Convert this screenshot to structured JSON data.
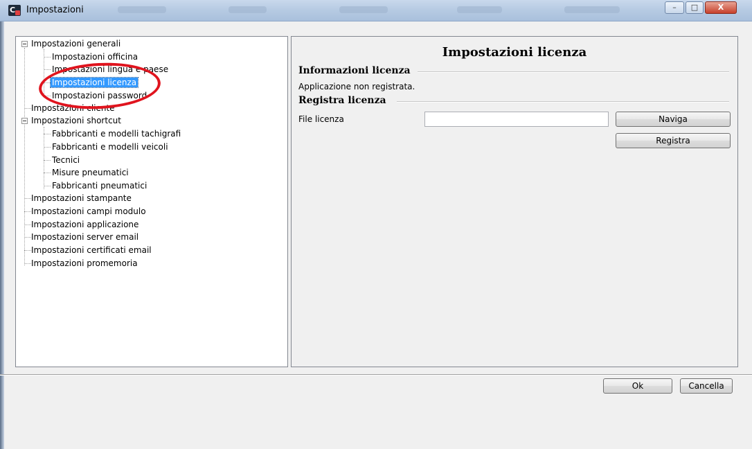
{
  "window": {
    "title": "Impostazioni",
    "controls": {
      "minimize": "–",
      "maximize": "□",
      "close": "X"
    }
  },
  "tree": {
    "items": [
      {
        "label": "Impostazioni generali",
        "level": 0,
        "expander": true
      },
      {
        "label": "Impostazioni officina",
        "level": 1
      },
      {
        "label": "Impostazioni lingua e paese",
        "level": 1
      },
      {
        "label": "Impostazioni licenza",
        "level": 1,
        "selected": true
      },
      {
        "label": "Impostazioni password",
        "level": 1
      },
      {
        "label": "Impostazioni cliente",
        "level": 0
      },
      {
        "label": "Impostazioni shortcut",
        "level": 0,
        "expander": true
      },
      {
        "label": "Fabbricanti e modelli tachigrafi",
        "level": 1
      },
      {
        "label": "Fabbricanti e modelli veicoli",
        "level": 1
      },
      {
        "label": "Tecnici",
        "level": 1
      },
      {
        "label": "Misure pneumatici",
        "level": 1
      },
      {
        "label": "Fabbricanti pneumatici",
        "level": 1
      },
      {
        "label": "Impostazioni stampante",
        "level": 0
      },
      {
        "label": "Impostazioni campi modulo",
        "level": 0
      },
      {
        "label": "Impostazioni applicazione",
        "level": 0
      },
      {
        "label": "Impostazioni server email",
        "level": 0
      },
      {
        "label": "Impostazioni certificati email",
        "level": 0
      },
      {
        "label": "Impostazioni promemoria",
        "level": 0
      }
    ]
  },
  "license": {
    "title": "Impostazioni licenza",
    "info_section": "Informazioni licenza",
    "status": "Applicazione non registrata.",
    "register_section": "Registra licenza",
    "file_label": "File licenza",
    "file_value": "",
    "browse_label": "Naviga",
    "register_label": "Registra"
  },
  "footer": {
    "ok_label": "Ok",
    "cancel_label": "Cancella"
  },
  "colors": {
    "selection": "#3399ff",
    "annotation": "#e0141e"
  }
}
